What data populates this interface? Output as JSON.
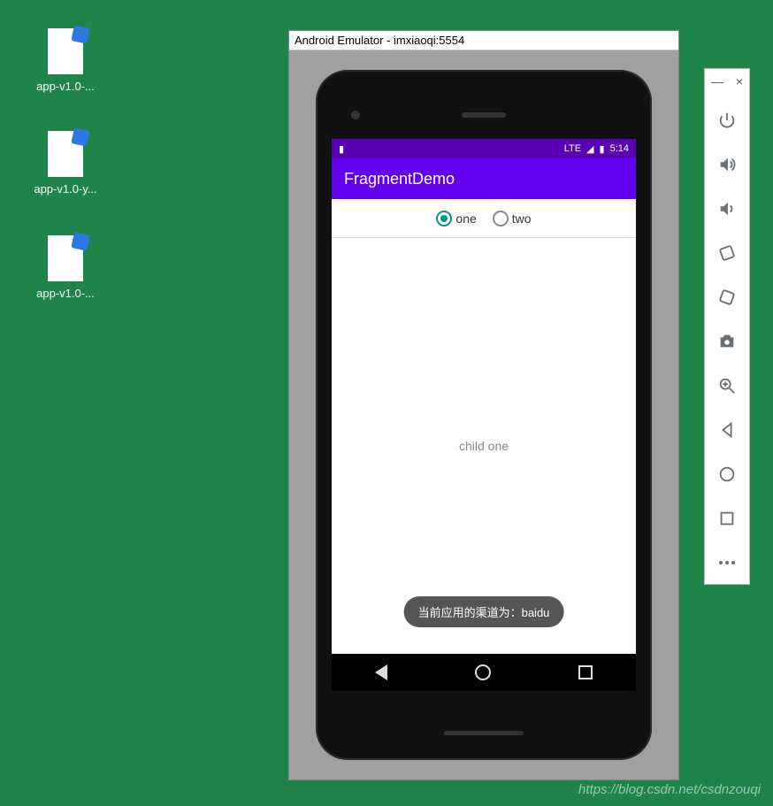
{
  "desktop": {
    "icons": [
      {
        "label": "app-v1.0-..."
      },
      {
        "label": "app-v1.0-y..."
      },
      {
        "label": "app-v1.0-..."
      }
    ]
  },
  "emulator": {
    "title": "Android Emulator - imxiaoqi:5554"
  },
  "phone": {
    "status": {
      "network": "LTE",
      "time": "5:14"
    },
    "app_title": "FragmentDemo",
    "radios": {
      "one": "one",
      "two": "two",
      "selected": "one"
    },
    "content_text": "child one",
    "toast": "当前应用的渠道为：baidu"
  },
  "toolbar": {
    "minimize": "—",
    "close": "×",
    "icons": {
      "power": "power-icon",
      "volume_up": "volume-up-icon",
      "volume_down": "volume-down-icon",
      "rotate_left": "rotate-left-icon",
      "rotate_right": "rotate-right-icon",
      "camera": "camera-icon",
      "zoom": "zoom-icon",
      "back": "back-icon",
      "home": "home-icon",
      "recent": "recent-icon",
      "more": "more-icon"
    }
  },
  "watermark": "https://blog.csdn.net/csdnzouqi"
}
